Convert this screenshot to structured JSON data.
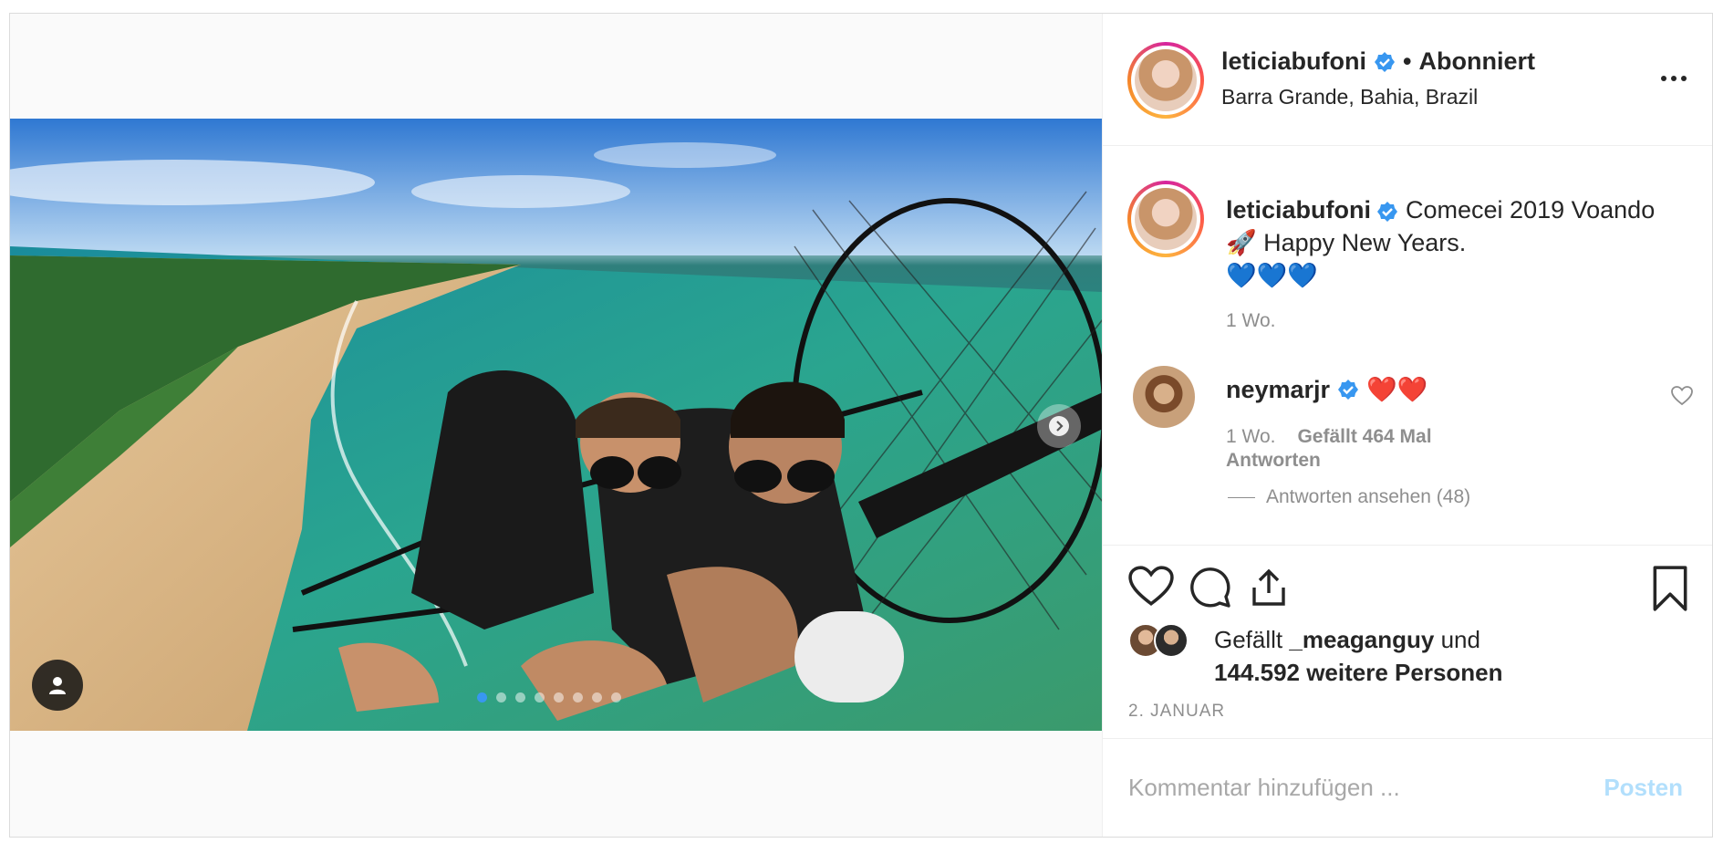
{
  "post": {
    "author": "leticiabufoni",
    "follow_separator": "•",
    "follow_status": "Abonniert",
    "location": "Barra Grande, Bahia, Brazil"
  },
  "caption": {
    "username": "leticiabufoni",
    "text_line1": "Comecei 2019 Voando",
    "text_line2": "🚀 Happy New Years.",
    "text_line3": "💙💙💙",
    "time": "1 Wo."
  },
  "comment": {
    "username": "neymarjr",
    "text": "❤️❤️",
    "time": "1 Wo.",
    "likes": "Gefällt 464 Mal",
    "reply": "Antworten",
    "view_replies": "Antworten ansehen (48)"
  },
  "likes": {
    "prefix": "Gefällt",
    "user": "_meaganguy",
    "connector": "und",
    "others": "144.592 weitere Personen"
  },
  "date": "2. JANUAR",
  "add_comment": {
    "placeholder": "Kommentar hinzufügen ...",
    "post_label": "Posten"
  },
  "carousel": {
    "count": 8,
    "active_index": 0
  },
  "colors": {
    "verified": "#3897f0",
    "post_button_disabled": "#b2dffc",
    "secondary_text": "#8e8e8e"
  },
  "icons": [
    "verified-icon",
    "more-icon",
    "heart-icon",
    "comment-icon",
    "share-icon",
    "bookmark-icon",
    "user-tag-icon",
    "chevron-right-icon"
  ]
}
